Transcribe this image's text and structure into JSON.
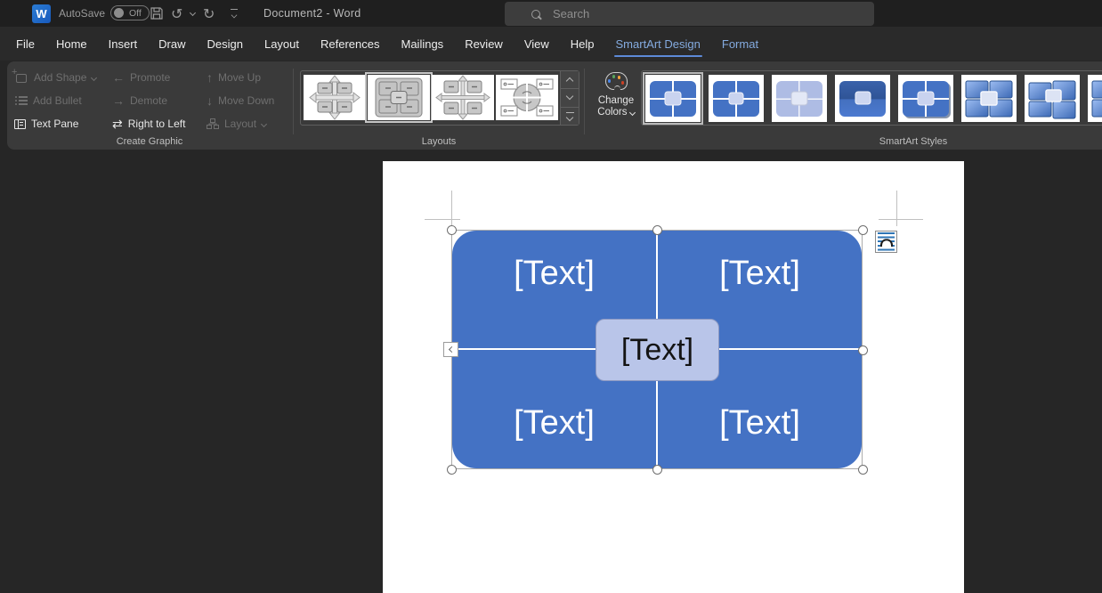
{
  "titlebar": {
    "logo_letter": "W",
    "autosave_label": "AutoSave",
    "autosave_state": "Off",
    "title": "Document2 - Word",
    "search_placeholder": "Search"
  },
  "menu": {
    "tabs": [
      {
        "label": "File"
      },
      {
        "label": "Home"
      },
      {
        "label": "Insert"
      },
      {
        "label": "Draw"
      },
      {
        "label": "Design"
      },
      {
        "label": "Layout"
      },
      {
        "label": "References"
      },
      {
        "label": "Mailings"
      },
      {
        "label": "Review"
      },
      {
        "label": "View"
      },
      {
        "label": "Help"
      },
      {
        "label": "SmartArt Design",
        "active": true
      },
      {
        "label": "Format",
        "contextual": true
      }
    ]
  },
  "ribbon": {
    "create_graphic": {
      "group_label": "Create Graphic",
      "add_shape": "Add Shape",
      "add_bullet": "Add Bullet",
      "text_pane": "Text Pane",
      "promote": "Promote",
      "demote": "Demote",
      "right_to_left": "Right to Left",
      "move_up": "Move Up",
      "move_down": "Move Down",
      "layout": "Layout"
    },
    "layouts": {
      "group_label": "Layouts",
      "selected_index": 1,
      "items": [
        "basic-matrix",
        "titled-matrix",
        "grid-matrix",
        "cycle-matrix"
      ]
    },
    "smartart_styles": {
      "group_label": "SmartArt Styles",
      "change_colors_label": "Change Colors",
      "selected_index": 0,
      "items": [
        "simple-fill-selected",
        "simple-fill",
        "subtle-effect",
        "intense-dark",
        "moderate-effect",
        "polished-3d",
        "inset-3d",
        "partial-3d"
      ]
    }
  },
  "document": {
    "smartart": {
      "quadrant_labels": [
        "[Text]",
        "[Text]",
        "[Text]",
        "[Text]"
      ],
      "center_label": "[Text]"
    }
  },
  "colors": {
    "accent_blue": "#4472C4",
    "center_box": "#B9C5E9",
    "active_tab": "#84ABE0"
  }
}
